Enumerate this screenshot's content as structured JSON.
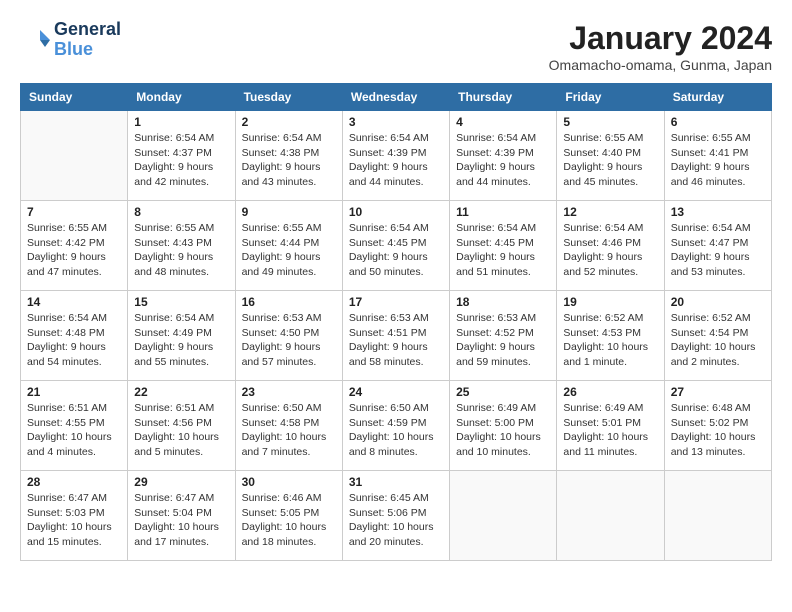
{
  "header": {
    "logo_line1": "General",
    "logo_line2": "Blue",
    "month_title": "January 2024",
    "location": "Omamacho-omama, Gunma, Japan"
  },
  "weekdays": [
    "Sunday",
    "Monday",
    "Tuesday",
    "Wednesday",
    "Thursday",
    "Friday",
    "Saturday"
  ],
  "weeks": [
    [
      {
        "day": "",
        "sunrise": "",
        "sunset": "",
        "daylight": ""
      },
      {
        "day": "1",
        "sunrise": "Sunrise: 6:54 AM",
        "sunset": "Sunset: 4:37 PM",
        "daylight": "Daylight: 9 hours and 42 minutes."
      },
      {
        "day": "2",
        "sunrise": "Sunrise: 6:54 AM",
        "sunset": "Sunset: 4:38 PM",
        "daylight": "Daylight: 9 hours and 43 minutes."
      },
      {
        "day": "3",
        "sunrise": "Sunrise: 6:54 AM",
        "sunset": "Sunset: 4:39 PM",
        "daylight": "Daylight: 9 hours and 44 minutes."
      },
      {
        "day": "4",
        "sunrise": "Sunrise: 6:54 AM",
        "sunset": "Sunset: 4:39 PM",
        "daylight": "Daylight: 9 hours and 44 minutes."
      },
      {
        "day": "5",
        "sunrise": "Sunrise: 6:55 AM",
        "sunset": "Sunset: 4:40 PM",
        "daylight": "Daylight: 9 hours and 45 minutes."
      },
      {
        "day": "6",
        "sunrise": "Sunrise: 6:55 AM",
        "sunset": "Sunset: 4:41 PM",
        "daylight": "Daylight: 9 hours and 46 minutes."
      }
    ],
    [
      {
        "day": "7",
        "sunrise": "Sunrise: 6:55 AM",
        "sunset": "Sunset: 4:42 PM",
        "daylight": "Daylight: 9 hours and 47 minutes."
      },
      {
        "day": "8",
        "sunrise": "Sunrise: 6:55 AM",
        "sunset": "Sunset: 4:43 PM",
        "daylight": "Daylight: 9 hours and 48 minutes."
      },
      {
        "day": "9",
        "sunrise": "Sunrise: 6:55 AM",
        "sunset": "Sunset: 4:44 PM",
        "daylight": "Daylight: 9 hours and 49 minutes."
      },
      {
        "day": "10",
        "sunrise": "Sunrise: 6:54 AM",
        "sunset": "Sunset: 4:45 PM",
        "daylight": "Daylight: 9 hours and 50 minutes."
      },
      {
        "day": "11",
        "sunrise": "Sunrise: 6:54 AM",
        "sunset": "Sunset: 4:45 PM",
        "daylight": "Daylight: 9 hours and 51 minutes."
      },
      {
        "day": "12",
        "sunrise": "Sunrise: 6:54 AM",
        "sunset": "Sunset: 4:46 PM",
        "daylight": "Daylight: 9 hours and 52 minutes."
      },
      {
        "day": "13",
        "sunrise": "Sunrise: 6:54 AM",
        "sunset": "Sunset: 4:47 PM",
        "daylight": "Daylight: 9 hours and 53 minutes."
      }
    ],
    [
      {
        "day": "14",
        "sunrise": "Sunrise: 6:54 AM",
        "sunset": "Sunset: 4:48 PM",
        "daylight": "Daylight: 9 hours and 54 minutes."
      },
      {
        "day": "15",
        "sunrise": "Sunrise: 6:54 AM",
        "sunset": "Sunset: 4:49 PM",
        "daylight": "Daylight: 9 hours and 55 minutes."
      },
      {
        "day": "16",
        "sunrise": "Sunrise: 6:53 AM",
        "sunset": "Sunset: 4:50 PM",
        "daylight": "Daylight: 9 hours and 57 minutes."
      },
      {
        "day": "17",
        "sunrise": "Sunrise: 6:53 AM",
        "sunset": "Sunset: 4:51 PM",
        "daylight": "Daylight: 9 hours and 58 minutes."
      },
      {
        "day": "18",
        "sunrise": "Sunrise: 6:53 AM",
        "sunset": "Sunset: 4:52 PM",
        "daylight": "Daylight: 9 hours and 59 minutes."
      },
      {
        "day": "19",
        "sunrise": "Sunrise: 6:52 AM",
        "sunset": "Sunset: 4:53 PM",
        "daylight": "Daylight: 10 hours and 1 minute."
      },
      {
        "day": "20",
        "sunrise": "Sunrise: 6:52 AM",
        "sunset": "Sunset: 4:54 PM",
        "daylight": "Daylight: 10 hours and 2 minutes."
      }
    ],
    [
      {
        "day": "21",
        "sunrise": "Sunrise: 6:51 AM",
        "sunset": "Sunset: 4:55 PM",
        "daylight": "Daylight: 10 hours and 4 minutes."
      },
      {
        "day": "22",
        "sunrise": "Sunrise: 6:51 AM",
        "sunset": "Sunset: 4:56 PM",
        "daylight": "Daylight: 10 hours and 5 minutes."
      },
      {
        "day": "23",
        "sunrise": "Sunrise: 6:50 AM",
        "sunset": "Sunset: 4:58 PM",
        "daylight": "Daylight: 10 hours and 7 minutes."
      },
      {
        "day": "24",
        "sunrise": "Sunrise: 6:50 AM",
        "sunset": "Sunset: 4:59 PM",
        "daylight": "Daylight: 10 hours and 8 minutes."
      },
      {
        "day": "25",
        "sunrise": "Sunrise: 6:49 AM",
        "sunset": "Sunset: 5:00 PM",
        "daylight": "Daylight: 10 hours and 10 minutes."
      },
      {
        "day": "26",
        "sunrise": "Sunrise: 6:49 AM",
        "sunset": "Sunset: 5:01 PM",
        "daylight": "Daylight: 10 hours and 11 minutes."
      },
      {
        "day": "27",
        "sunrise": "Sunrise: 6:48 AM",
        "sunset": "Sunset: 5:02 PM",
        "daylight": "Daylight: 10 hours and 13 minutes."
      }
    ],
    [
      {
        "day": "28",
        "sunrise": "Sunrise: 6:47 AM",
        "sunset": "Sunset: 5:03 PM",
        "daylight": "Daylight: 10 hours and 15 minutes."
      },
      {
        "day": "29",
        "sunrise": "Sunrise: 6:47 AM",
        "sunset": "Sunset: 5:04 PM",
        "daylight": "Daylight: 10 hours and 17 minutes."
      },
      {
        "day": "30",
        "sunrise": "Sunrise: 6:46 AM",
        "sunset": "Sunset: 5:05 PM",
        "daylight": "Daylight: 10 hours and 18 minutes."
      },
      {
        "day": "31",
        "sunrise": "Sunrise: 6:45 AM",
        "sunset": "Sunset: 5:06 PM",
        "daylight": "Daylight: 10 hours and 20 minutes."
      },
      {
        "day": "",
        "sunrise": "",
        "sunset": "",
        "daylight": ""
      },
      {
        "day": "",
        "sunrise": "",
        "sunset": "",
        "daylight": ""
      },
      {
        "day": "",
        "sunrise": "",
        "sunset": "",
        "daylight": ""
      }
    ]
  ]
}
